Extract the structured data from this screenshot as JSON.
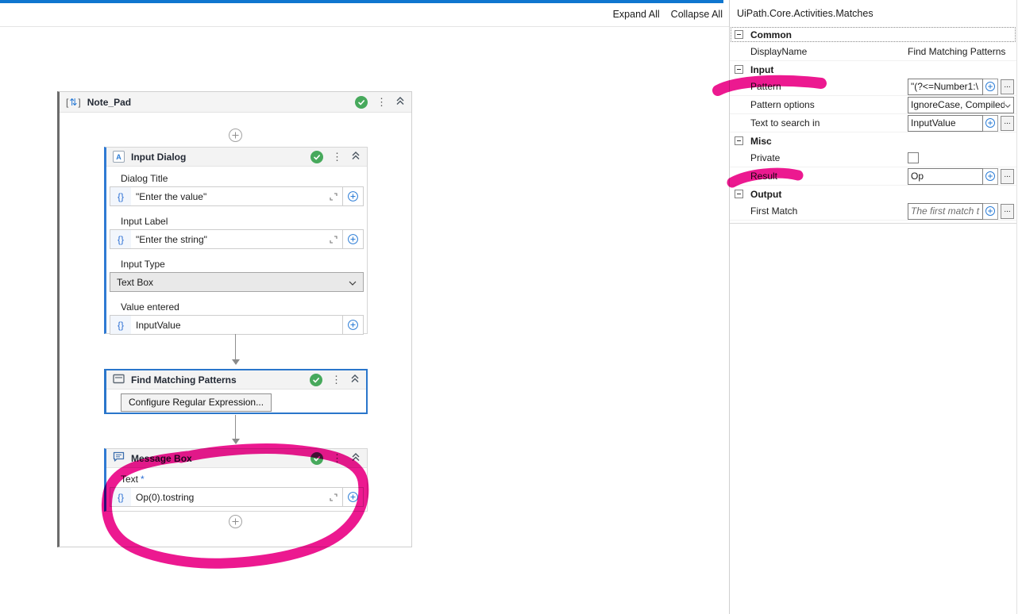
{
  "ui": {
    "braces": "{}",
    "ellipsis": "...",
    "kebab": "⋮"
  },
  "toolbar": {
    "expand_all": "Expand All",
    "collapse_all": "Collapse All"
  },
  "canvas": {
    "sequence_title": "Note_Pad",
    "input_dialog": {
      "title": "Input Dialog",
      "dialog_title_label": "Dialog Title",
      "dialog_title_value": "\"Enter the value\"",
      "input_label_label": "Input Label",
      "input_label_value": "\"Enter the string\"",
      "input_type_label": "Input Type",
      "input_type_value": "Text Box",
      "value_entered_label": "Value entered",
      "value_entered_value": "InputValue"
    },
    "find_matching": {
      "title": "Find Matching Patterns",
      "configure_button": "Configure Regular Expression..."
    },
    "message_box": {
      "title": "Message Box",
      "text_label": "Text",
      "required_mark": "*",
      "text_value": "Op(0).tostring"
    }
  },
  "properties": {
    "panel_title": "UiPath.Core.Activities.Matches",
    "sections": {
      "common": "Common",
      "input": "Input",
      "misc": "Misc",
      "output": "Output"
    },
    "rows": {
      "display_name": {
        "label": "DisplayName",
        "value": "Find Matching Patterns"
      },
      "pattern": {
        "label": "Pattern",
        "value": "\"(?<=Number1:\\"
      },
      "pattern_options": {
        "label": "Pattern options",
        "value": "IgnoreCase, Compiled"
      },
      "text_to_search": {
        "label": "Text to search in",
        "value": "InputValue"
      },
      "private": {
        "label": "Private"
      },
      "result": {
        "label": "Result",
        "value": "Op"
      },
      "first_match": {
        "label": "First Match",
        "placeholder": "The first match t"
      }
    }
  },
  "colors": {
    "accent_blue": "#0f76cf",
    "selection_blue": "#2a76cb",
    "highlight_pink": "#ec1990",
    "check_green": "#47a95c"
  }
}
